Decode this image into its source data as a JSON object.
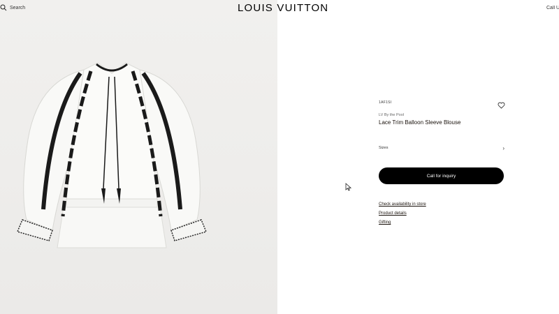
{
  "header": {
    "search_label": "Search",
    "logo": "LOUIS VUITTON",
    "right_label": "Call Us"
  },
  "product": {
    "sku": "1AF1SI",
    "collection": "LV By the Pool",
    "name": "Lace Trim Balloon Sleeve Blouse",
    "size_label": "Sizes",
    "cta_label": "Call for inquiry",
    "links": [
      "Check availability in store",
      "Product details",
      "Gifting"
    ]
  },
  "icons": {
    "search": "search-icon",
    "wishlist": "heart-icon",
    "size_chevron": "chevron-right-icon",
    "cursor": "mouse-cursor-icon"
  },
  "colors": {
    "brand_black": "#000000",
    "image_bg": "#efeeec",
    "text": "#19110b"
  }
}
